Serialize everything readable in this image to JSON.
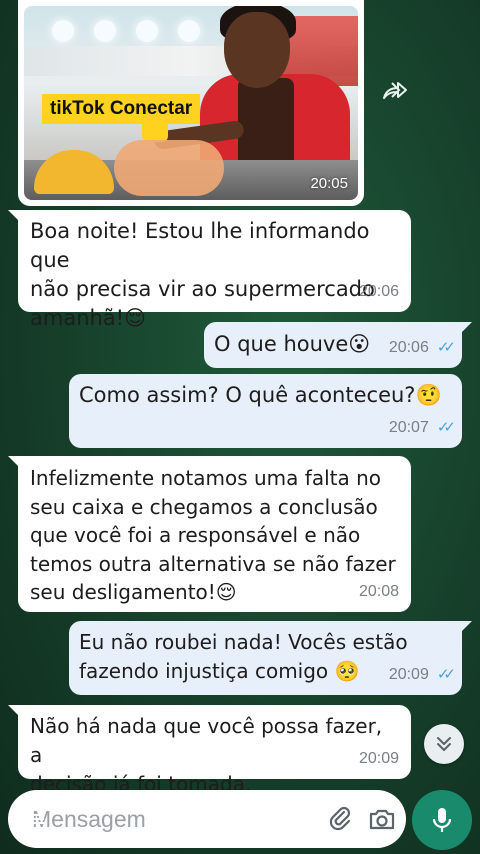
{
  "image_message": {
    "badge": "tikTok Conectar",
    "time": "20:05"
  },
  "messages": [
    {
      "dir": "in",
      "text": "Boa noite! Estou lhe informando que\nnão precisa vir ao supermercado\namanhã!😌",
      "time": "20:06"
    },
    {
      "dir": "out",
      "text": "O que houve😮",
      "time": "20:06",
      "ticks": "✓✓"
    },
    {
      "dir": "out",
      "text": "Como assim? O quê aconteceu?🤨",
      "time": "20:07",
      "ticks": "✓✓"
    },
    {
      "dir": "in",
      "text": "Infelizmente notamos uma falta no\nseu caixa e chegamos a conclusão\nque você foi a responsável e não\ntemos outra alternativa se não fazer\nseu desligamento!😌",
      "time": "20:08"
    },
    {
      "dir": "out",
      "text": "Eu não roubei nada! Vocês estão\nfazendo injustiça comigo 🥺",
      "time": "20:09",
      "ticks": "✓✓"
    },
    {
      "dir": "in",
      "text": "Não há nada que você possa fazer, a\ndecisão já foi tomada,",
      "time": "20:09"
    }
  ],
  "composer": {
    "placeholder": "Mensagem"
  },
  "icons": {
    "forward": "forward-icon",
    "scroll_down": "chevron-double-down-icon",
    "keyboard": "keyboard-icon",
    "attach": "paperclip-icon",
    "camera": "camera-icon",
    "mic": "microphone-icon"
  },
  "colors": {
    "accent": "#1a8a6c",
    "incoming_bubble": "#ffffff",
    "outgoing_bubble": "#e7effb",
    "read_ticks": "#4aa3df",
    "badge": "#ffd21f"
  }
}
